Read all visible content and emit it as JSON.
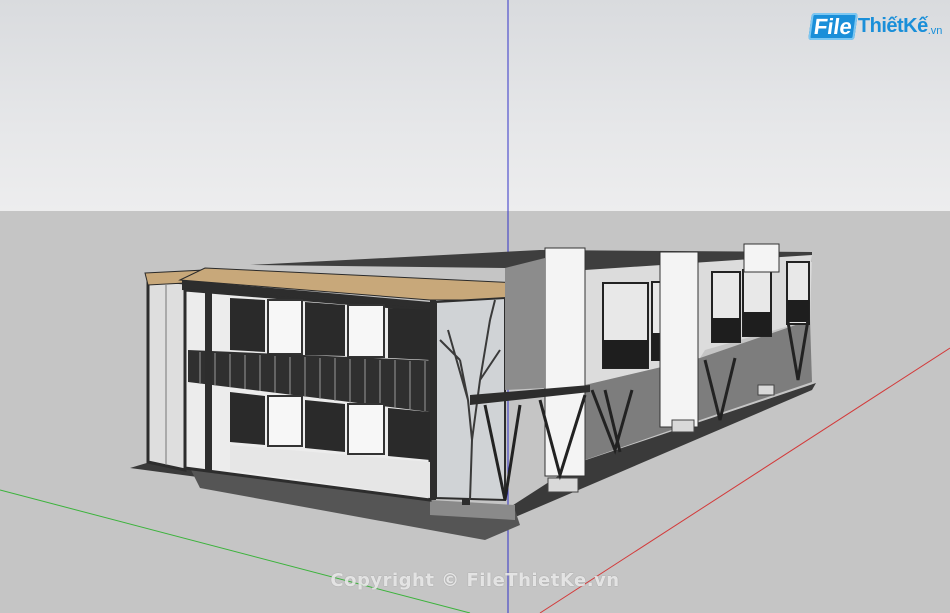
{
  "logo": {
    "brand_file": "File",
    "brand_rest": "ThiếtKế",
    "brand_tld": ".vn",
    "accent_color": "#1a8fd9"
  },
  "watermark": {
    "text": "Copyright © FileThietKe.vn"
  },
  "scene": {
    "axes": {
      "green_axis_color": "#3bb33b",
      "red_axis_color": "#d33a3a",
      "blue_axis_color": "#3434c8"
    },
    "sky_color": "#e6e7e9",
    "ground_color": "#c5c5c5",
    "roof_color": "#c8a87a",
    "frame_color": "#2d2d2d",
    "wall_color": "#f2f2f2"
  }
}
